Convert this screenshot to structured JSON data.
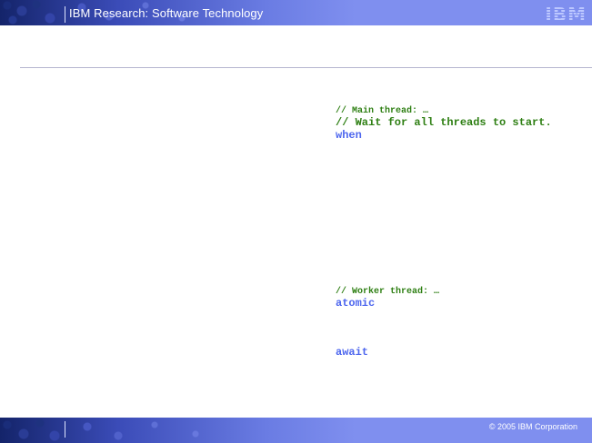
{
  "header": {
    "title": "IBM Research: Software Technology",
    "logo_text": "IBM"
  },
  "code": {
    "main": {
      "comment": "// Main thread: …",
      "wait_comment": "// Wait for all threads to start.",
      "keyword": "when"
    },
    "worker": {
      "comment": "// Worker thread: …",
      "atomic_keyword": "atomic",
      "await_keyword": "await"
    }
  },
  "footer": {
    "copyright": "© 2005 IBM Corporation"
  },
  "colors": {
    "header_band": "#7f8fef",
    "comment": "#2e7f13",
    "keyword": "#4d66ee",
    "rule": "#b6b6cf"
  }
}
